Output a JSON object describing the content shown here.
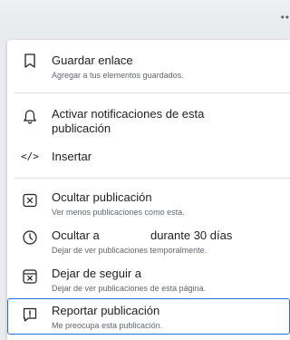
{
  "header": {
    "more_label": "••"
  },
  "menu": {
    "save": {
      "label": "Guardar enlace",
      "sub": "Agregar a tus elementos guardados.",
      "icon": "bookmark-icon"
    },
    "notify": {
      "label_line1": "Activar notificaciones de esta",
      "label_line2": "publicación",
      "icon": "bell-icon"
    },
    "embed": {
      "label": "Insertar",
      "icon_glyph": "</>",
      "icon": "code-icon"
    },
    "hide": {
      "label": "Ocultar publicación",
      "sub": "Ver menos publicaciones como esta.",
      "icon": "hide-box-icon"
    },
    "snooze": {
      "label": "Ocultar a",
      "label_suffix": "durante 30 días",
      "sub": "Dejar de ver publicaciones temporalmente.",
      "icon": "clock-icon"
    },
    "unfollow": {
      "label": "Dejar de seguir a",
      "sub": "Dejar de ver publicaciones de esta página.",
      "icon": "unfollow-icon"
    },
    "report": {
      "label": "Reportar publicación",
      "sub": "Me preocupa esta publicación.",
      "icon": "report-flag-icon"
    }
  },
  "colors": {
    "accent": "#1b74e4",
    "text": "#1c1e21",
    "subtext": "#606770"
  }
}
